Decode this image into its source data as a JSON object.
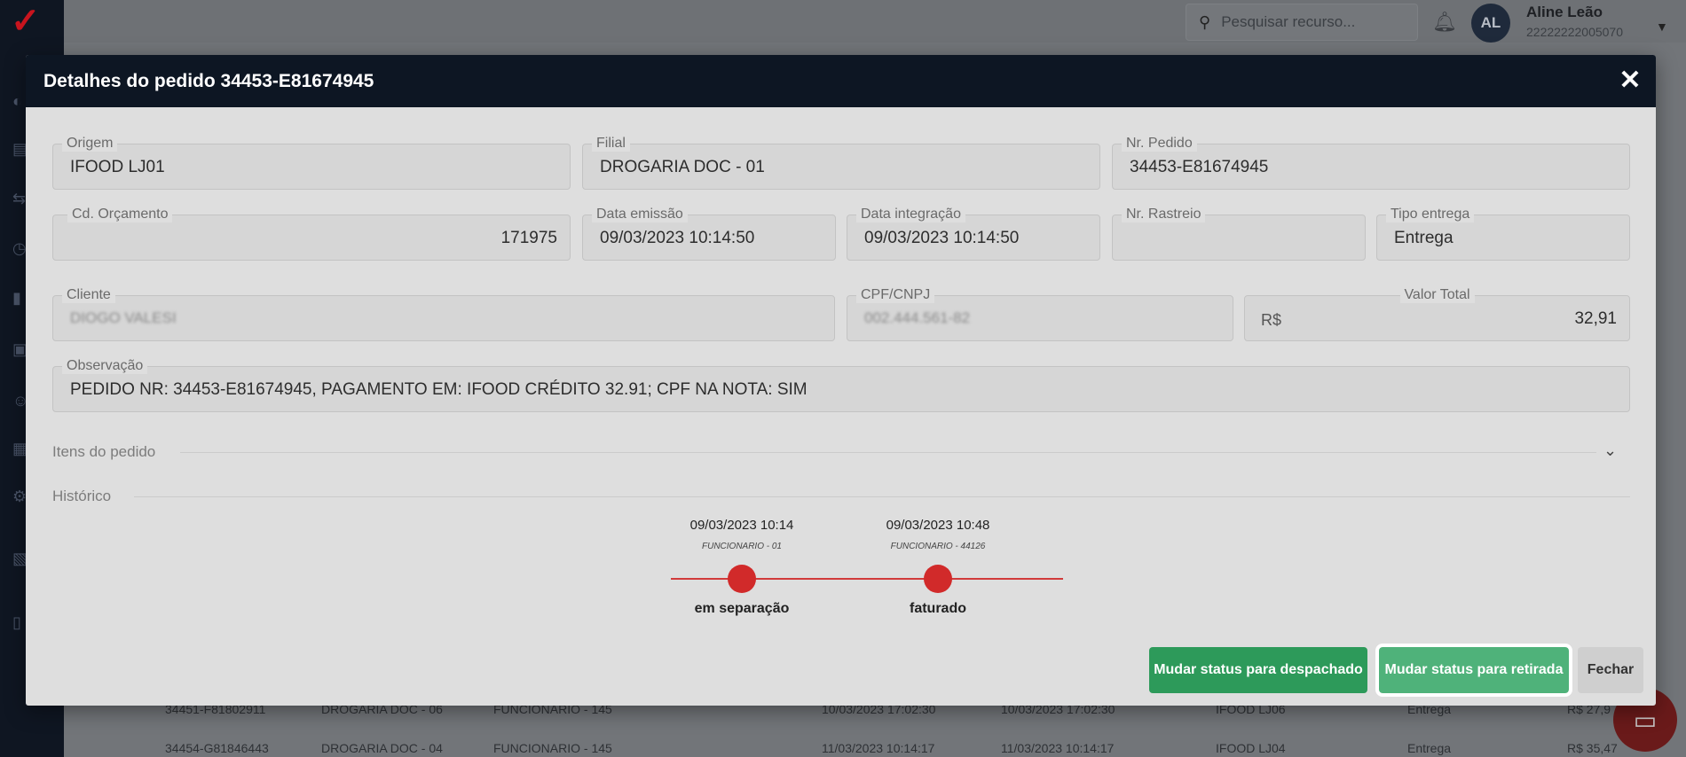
{
  "topbar": {
    "search_placeholder": "Pesquisar recurso...",
    "avatar_initials": "AL",
    "user_name": "Aline Leão",
    "user_id": "22222222005070"
  },
  "background_rows": [
    [
      "34451-F81802911",
      "DROGARIA DOC - 06",
      "FUNCIONARIO - 145",
      "10/03/2023 17:02:30",
      "10/03/2023 17:02:30",
      "IFOOD LJ06",
      "Entrega",
      "R$ 27,9"
    ],
    [
      "34454-G81846443",
      "DROGARIA DOC - 04",
      "FUNCIONARIO - 145",
      "11/03/2023 10:14:17",
      "11/03/2023 10:14:17",
      "IFOOD LJ04",
      "Entrega",
      "R$ 35,47"
    ]
  ],
  "modal": {
    "title": "Detalhes do pedido 34453-E81674945",
    "fields": {
      "origem": {
        "label": "Origem",
        "value": "IFOOD LJ01"
      },
      "filial": {
        "label": "Filial",
        "value": "DROGARIA DOC - 01"
      },
      "nr_pedido": {
        "label": "Nr. Pedido",
        "value": "34453-E81674945"
      },
      "cd_orcamento": {
        "label": "Cd. Orçamento",
        "value": "171975"
      },
      "data_emissao": {
        "label": "Data emissão",
        "value": "09/03/2023 10:14:50"
      },
      "data_integracao": {
        "label": "Data integração",
        "value": "09/03/2023 10:14:50"
      },
      "nr_rastreio": {
        "label": "Nr. Rastreio",
        "value": ""
      },
      "tipo_entrega": {
        "label": "Tipo entrega",
        "value": "Entrega"
      },
      "cliente": {
        "label": "Cliente",
        "value": "DIOGO VALESI"
      },
      "cpf_cnpj": {
        "label": "CPF/CNPJ",
        "value": "002.444.561-82"
      },
      "valor_total": {
        "label": "Valor Total",
        "prefix": "R$",
        "value": "32,91"
      },
      "observacao": {
        "label": "Observação",
        "value": "PEDIDO NR: 34453-E81674945, PAGAMENTO EM: IFOOD CRÉDITO 32.91; CPF NA NOTA: SIM"
      }
    },
    "sections": {
      "itens": "Itens do pedido",
      "historico": "Histórico"
    },
    "timeline": [
      {
        "date": "09/03/2023 10:14",
        "user": "FUNCIONARIO - 01",
        "status": "em separação"
      },
      {
        "date": "09/03/2023 10:48",
        "user": "FUNCIONARIO - 44126",
        "status": "faturado"
      }
    ],
    "buttons": {
      "despachado": "Mudar status para despachado",
      "retirada": "Mudar status para retirada",
      "fechar": "Fechar"
    }
  },
  "colors": {
    "header": "#0d1623",
    "accent_red": "#d12a2a",
    "button_green": "#2d9a5a"
  }
}
